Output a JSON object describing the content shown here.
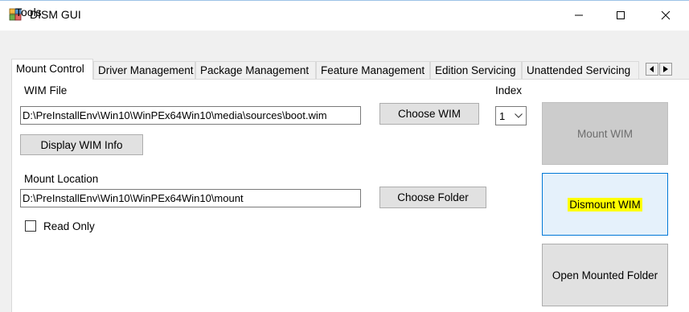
{
  "window": {
    "title": "DISM GUI",
    "icons": {
      "app": "dism-app-icon",
      "minimize": "minimize-icon",
      "maximize": "maximize-icon",
      "close": "close-icon"
    }
  },
  "menu": {
    "tools": "Tools"
  },
  "tabs": [
    {
      "label": "Mount Control",
      "selected": true
    },
    {
      "label": "Driver Management"
    },
    {
      "label": "Package Management"
    },
    {
      "label": "Feature Management"
    },
    {
      "label": "Edition Servicing"
    },
    {
      "label": "Unattended Servicing"
    }
  ],
  "mount_control": {
    "wim_file_label": "WIM File",
    "wim_file_value": "D:\\PreInstallEnv\\Win10\\WinPEx64Win10\\media\\sources\\boot.wim",
    "choose_wim": "Choose WIM",
    "display_wim_info": "Display WIM Info",
    "index_label": "Index",
    "index_value": "1",
    "mount_location_label": "Mount Location",
    "mount_location_value": "D:\\PreInstallEnv\\Win10\\WinPEx64Win10\\mount",
    "choose_folder": "Choose Folder",
    "read_only_label": "Read Only",
    "read_only_checked": false,
    "mount_wim": "Mount WIM",
    "dismount_wim": "Dismount WIM",
    "open_mounted_folder": "Open Mounted Folder"
  },
  "colors": {
    "highlight": "#ffff00",
    "focused_button_border": "#0078d7",
    "disabled_button": "#cccccc"
  }
}
